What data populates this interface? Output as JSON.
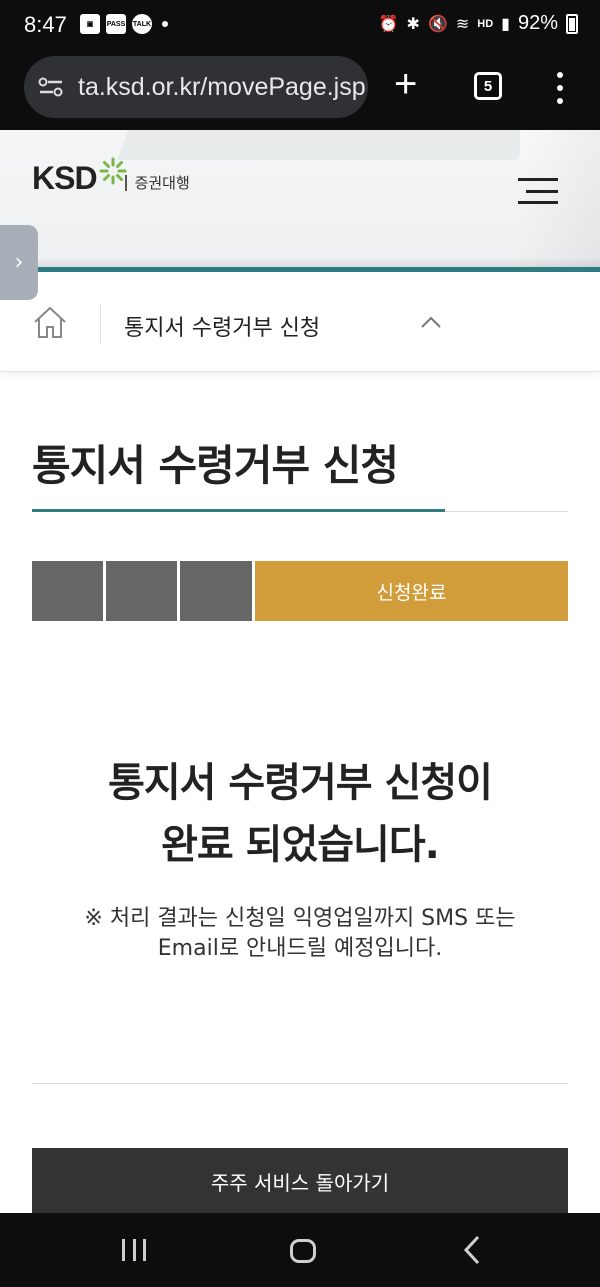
{
  "status_bar": {
    "time": "8:47",
    "notif_icons": [
      "gallery-icon",
      "pass-icon",
      "talk-icon"
    ],
    "pass_label": "PASS",
    "talk_label": "TALK",
    "hd_label": "HD",
    "battery": "92%"
  },
  "browser": {
    "url": "ta.ksd.or.kr/movePage.jsp",
    "tab_count": "5"
  },
  "header": {
    "logo_text": "KSD",
    "logo_sub": "증권대행"
  },
  "breadcrumb": {
    "current": "통지서 수령거부 신청"
  },
  "page": {
    "title": "통지서 수령거부 신청",
    "steps": [
      "",
      "",
      "",
      "신청완료"
    ],
    "active_step": 4,
    "done_line1": "통지서 수령거부 신청이",
    "done_line2": "완료 되었습니다.",
    "note_line1": "※ 처리 결과는 신청일 익영업일까지 SMS 또는",
    "note_line2": "Email로 안내드릴 예정입니다.",
    "back_button": "주주 서비스 돌아가기"
  },
  "colors": {
    "accent_teal": "#2f7d82",
    "step_active": "#d19d3a",
    "step_inactive": "#666666",
    "button_dark": "#333333"
  }
}
